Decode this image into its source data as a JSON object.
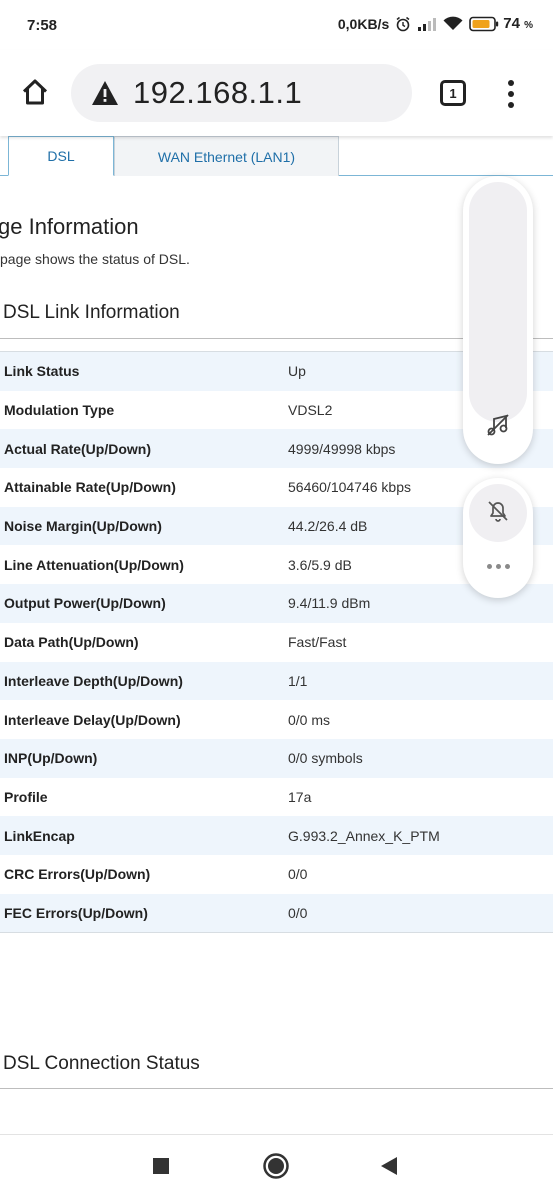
{
  "status_bar": {
    "time": "7:58",
    "net_speed": "0,0KB/s",
    "battery_level": "74",
    "battery_unit": "%",
    "icons": [
      "alarm-icon",
      "signal-icon",
      "wifi-icon",
      "battery-icon"
    ]
  },
  "browser": {
    "url": "192.168.1.1",
    "tab_count": "1",
    "icons": [
      "home-icon",
      "warning-icon",
      "tabs-icon",
      "overflow-menu-icon"
    ]
  },
  "tabs": [
    {
      "label": "DSL"
    },
    {
      "label": "WAN Ethernet (LAN1)"
    }
  ],
  "page": {
    "title": "ge Information",
    "description": "page shows the status of DSL."
  },
  "link_section": {
    "title": "DSL Link Information",
    "rows": [
      {
        "label": "Link Status",
        "value": "Up"
      },
      {
        "label": "Modulation Type",
        "value": "VDSL2"
      },
      {
        "label": "Actual Rate(Up/Down)",
        "value": "4999/49998 kbps"
      },
      {
        "label": "Attainable Rate(Up/Down)",
        "value": "56460/104746 kbps"
      },
      {
        "label": "Noise Margin(Up/Down)",
        "value": "44.2/26.4 dB"
      },
      {
        "label": "Line Attenuation(Up/Down)",
        "value": "3.6/5.9 dB"
      },
      {
        "label": "Output Power(Up/Down)",
        "value": "9.4/11.9 dBm"
      },
      {
        "label": "Data Path(Up/Down)",
        "value": "Fast/Fast"
      },
      {
        "label": "Interleave Depth(Up/Down)",
        "value": "1/1"
      },
      {
        "label": "Interleave Delay(Up/Down)",
        "value": "0/0 ms"
      },
      {
        "label": "INP(Up/Down)",
        "value": "0/0 symbols"
      },
      {
        "label": "Profile",
        "value": "17a"
      },
      {
        "label": "LinkEncap",
        "value": "G.993.2_Annex_K_PTM"
      },
      {
        "label": "CRC Errors(Up/Down)",
        "value": "0/0"
      },
      {
        "label": "FEC Errors(Up/Down)",
        "value": "0/0"
      }
    ]
  },
  "connection_section": {
    "title": "DSL Connection Status"
  },
  "floating_widget": {
    "icons": [
      "music-off-icon",
      "bell-off-icon",
      "more-dots-icon"
    ]
  },
  "nav_bar": {
    "icons": [
      "recent-apps-icon",
      "home-circle-icon",
      "back-icon"
    ]
  }
}
